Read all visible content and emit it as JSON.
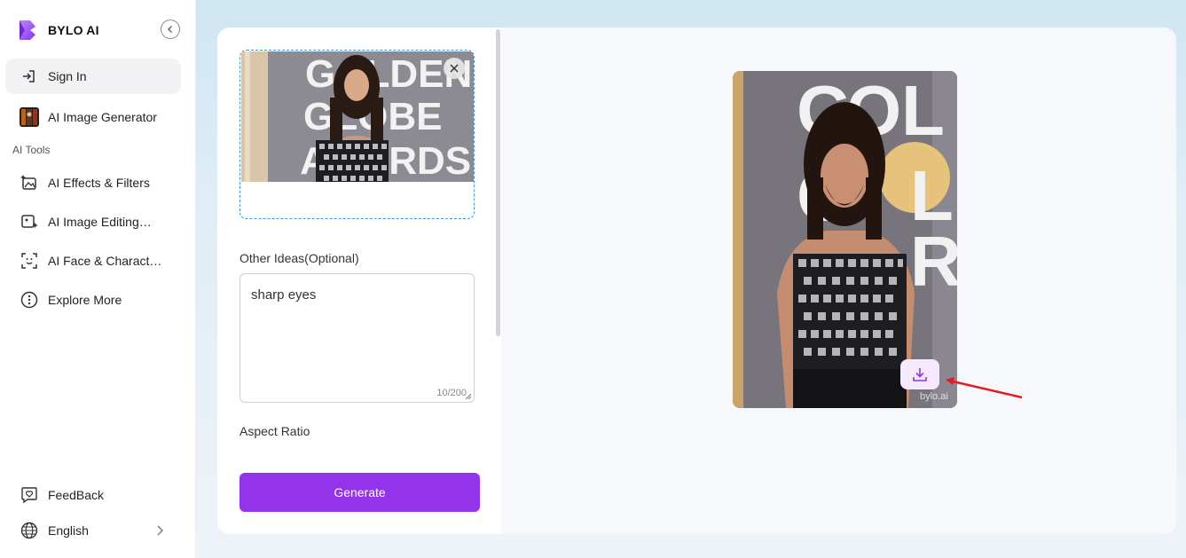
{
  "app": {
    "name": "BYLO AI"
  },
  "sidebar": {
    "sign_in": "Sign In",
    "image_generator": "AI Image Generator",
    "section_label": "AI Tools",
    "tools": [
      {
        "label": "AI Effects & Filters",
        "icon": "sparkle-image-icon"
      },
      {
        "label": "AI Image Editing…",
        "icon": "image-edit-icon"
      },
      {
        "label": "AI Face & Charact…",
        "icon": "face-scan-icon"
      },
      {
        "label": "Explore More",
        "icon": "more-icon"
      }
    ],
    "feedback": "FeedBack",
    "language": "English"
  },
  "form": {
    "other_ideas_label": "Other Ideas(Optional)",
    "other_ideas_value": "sharp eyes",
    "char_counter": "10/200",
    "aspect_ratio_label": "Aspect Ratio",
    "generate_label": "Generate"
  },
  "thumbnail_text": {
    "line1": "GOLDEN",
    "line2": "GLOBE",
    "line3": "AWARDS"
  },
  "result": {
    "watermark": "bylo.ai"
  },
  "colors": {
    "accent": "#9333ea",
    "upload_border": "#3b95e0",
    "arrow": "#e11d1d"
  }
}
